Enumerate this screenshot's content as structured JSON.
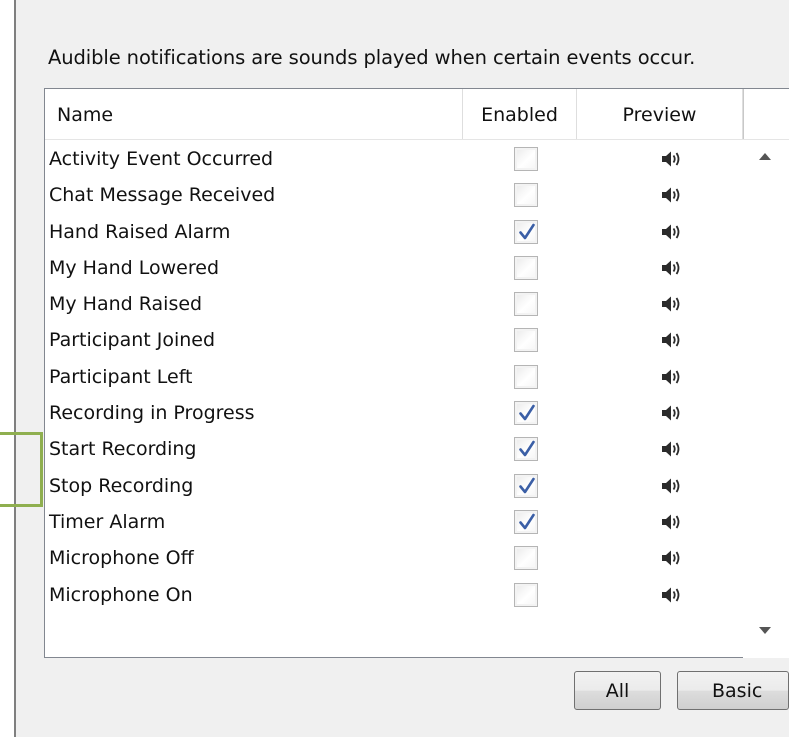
{
  "description": "Audible notifications are sounds played when certain events occur.",
  "columns": {
    "name": "Name",
    "enabled": "Enabled",
    "preview": "Preview"
  },
  "rows": [
    {
      "name": "Activity Event Occurred",
      "enabled": false
    },
    {
      "name": "Chat Message Received",
      "enabled": false
    },
    {
      "name": "Hand Raised Alarm",
      "enabled": true
    },
    {
      "name": "My Hand Lowered",
      "enabled": false
    },
    {
      "name": "My Hand Raised",
      "enabled": false
    },
    {
      "name": "Participant Joined",
      "enabled": false
    },
    {
      "name": "Participant Left",
      "enabled": false
    },
    {
      "name": "Recording in Progress",
      "enabled": true
    },
    {
      "name": "Start Recording",
      "enabled": true
    },
    {
      "name": "Stop Recording",
      "enabled": true
    },
    {
      "name": "Timer Alarm",
      "enabled": true
    },
    {
      "name": "Microphone Off",
      "enabled": false
    },
    {
      "name": "Microphone On",
      "enabled": false
    }
  ],
  "preview_icon": "speaker-icon",
  "buttons": {
    "all": "All",
    "basic": "Basic"
  },
  "colors": {
    "check": "#3b5fa6",
    "highlight_box": "#8faf4f"
  }
}
